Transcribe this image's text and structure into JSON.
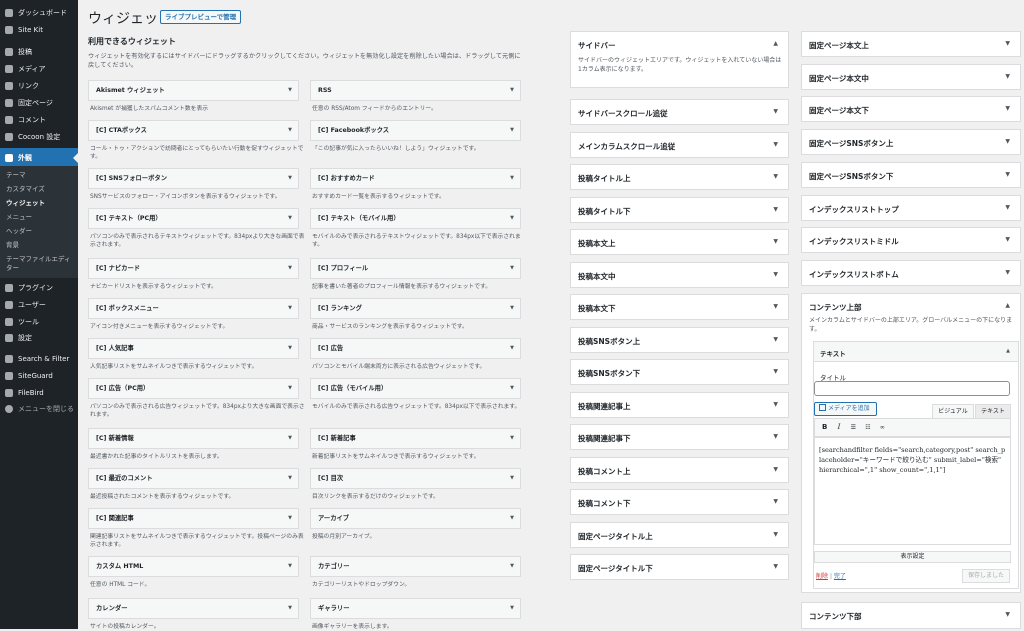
{
  "admin_menu": {
    "dashboard": "ダッシュボード",
    "sitekit": "Site Kit",
    "posts": "投稿",
    "media": "メディア",
    "links": "リンク",
    "pages": "固定ページ",
    "comments": "コメント",
    "cocoon": "Cocoon 設定",
    "appearance": "外観",
    "sub": [
      "テーマ",
      "カスタマイズ",
      "ウィジェット",
      "メニュー",
      "ヘッダー",
      "背景",
      "テーマファイルエディ",
      "ター"
    ],
    "plugins": "プラグイン",
    "users": "ユーザー",
    "tools": "ツール",
    "settings": "設定",
    "searchfilter": "Search & Filter",
    "siteguard": "SiteGuard",
    "filebird": "FileBird",
    "collapse": "メニューを閉じる"
  },
  "page": {
    "title": "ウィジェット",
    "live_preview": "ライブプレビューで管理",
    "available_heading": "利用できるウィジェット",
    "available_desc": "ウィジェットを有効化するにはサイドバーにドラッグするかクリックしてください。ウィジェットを無効化し設定を削除したい場合は、ドラッグして元側に戻してください。"
  },
  "widgets": [
    {
      "name": "Akismet ウィジェット",
      "desc": "Akismet が捕獲したスパムコメント数を表示"
    },
    {
      "name": "RSS",
      "desc": "任意の RSS/Atom フィードからのエントリー。"
    },
    {
      "name": "[C] CTAボックス",
      "desc": "コール・トゥ・アクションで訪問者にとってもらいたい行動を促すウィジェットです。"
    },
    {
      "name": "[C] Facebookボックス",
      "desc": "「この記事が気に入ったらいいね！しよう」ウィジェットです。"
    },
    {
      "name": "[C] SNSフォローボタン",
      "desc": "SNSサービスのフォロー・アイコンボタンを表示するウィジェットです。"
    },
    {
      "name": "[C] おすすめカード",
      "desc": "おすすめカード一覧を表示するウィジェットです。"
    },
    {
      "name": "[C] テキスト（PC用）",
      "desc": "パソコンのみで表示されるテキストウィジェットです。834pxより大きな画面で表示されます。"
    },
    {
      "name": "[C] テキスト（モバイル用）",
      "desc": "モバイルのみで表示されるテキストウィジェットです。834px以下で表示されます。"
    },
    {
      "name": "[C] ナビカード",
      "desc": "ナビカードリストを表示するウィジェットです。"
    },
    {
      "name": "[C] プロフィール",
      "desc": "記事を書いた著者のプロフィール情報を表示するウィジェットです。"
    },
    {
      "name": "[C] ボックスメニュー",
      "desc": "アイコン付きメニューを表示するウィジェットです。"
    },
    {
      "name": "[C] ランキング",
      "desc": "商品・サービスのランキングを表示するウィジェットです。"
    },
    {
      "name": "[C] 人気記事",
      "desc": "人気記事リストをサムネイルつきで表示するウィジェットです。"
    },
    {
      "name": "[C] 広告",
      "desc": "パソコンとモバイル端末両方に表示される広告ウィジェットです。"
    },
    {
      "name": "[C] 広告（PC用）",
      "desc": "パソコンのみで表示される広告ウィジェットです。834pxより大きな画面で表示されます。"
    },
    {
      "name": "[C] 広告（モバイル用）",
      "desc": "モバイルのみで表示される広告ウィジェットです。834px以下で表示されます。"
    },
    {
      "name": "[C] 新着情報",
      "desc": "最近書かれた記事のタイトルリストを表示します。"
    },
    {
      "name": "[C] 新着記事",
      "desc": "新着記事リストをサムネイルつきで表示するウィジェットです。"
    },
    {
      "name": "[C] 最近のコメント",
      "desc": "最近投稿されたコメントを表示するウィジェットです。"
    },
    {
      "name": "[C] 目次",
      "desc": "目次リンクを表示するだけのウィジェットです。"
    },
    {
      "name": "[C] 関連記事",
      "desc": "関連記事リストをサムネイルつきで表示するウィジェットです。投稿ページのみ表示されます。"
    },
    {
      "name": "アーカイブ",
      "desc": "投稿の月別アーカイブ。"
    },
    {
      "name": "カスタム HTML",
      "desc": "任意の HTML コード。"
    },
    {
      "name": "カテゴリー",
      "desc": "カテゴリーリストやドロップダウン。"
    },
    {
      "name": "カレンダー",
      "desc": "サイトの投稿カレンダー。"
    },
    {
      "name": "ギャラリー",
      "desc": "画像ギャラリーを表示します。"
    }
  ],
  "areas_mid": [
    {
      "name": "サイドバー",
      "desc": "サイドバーのウィジェットエリアです。ウィジェットを入れていない場合は1カラム表示になります。",
      "open": true
    },
    {
      "name": "サイドバースクロール追従"
    },
    {
      "name": "メインカラムスクロール追従"
    },
    {
      "name": "投稿タイトル上"
    },
    {
      "name": "投稿タイトル下"
    },
    {
      "name": "投稿本文上"
    },
    {
      "name": "投稿本文中"
    },
    {
      "name": "投稿本文下"
    },
    {
      "name": "投稿SNSボタン上"
    },
    {
      "name": "投稿SNSボタン下"
    },
    {
      "name": "投稿関連記事上"
    },
    {
      "name": "投稿関連記事下"
    },
    {
      "name": "投稿コメント上"
    },
    {
      "name": "投稿コメント下"
    },
    {
      "name": "固定ページタイトル上"
    },
    {
      "name": "固定ページタイトル下"
    }
  ],
  "areas_right": [
    {
      "name": "固定ページ本文上"
    },
    {
      "name": "固定ページ本文中"
    },
    {
      "name": "固定ページ本文下"
    },
    {
      "name": "固定ページSNSボタン上"
    },
    {
      "name": "固定ページSNSボタン下"
    },
    {
      "name": "インデックスリストトップ"
    },
    {
      "name": "インデックスリストミドル"
    },
    {
      "name": "インデックスリストボトム"
    },
    {
      "name": "コンテンツ上部",
      "desc": "メインカラムとサイドバーの上部エリア。グローバルメニューの下になります。"
    },
    {
      "name": "コンテンツ下部"
    }
  ],
  "text_widget": {
    "header": "テキスト",
    "title_label": "タイトル",
    "title_value": "",
    "add_media": "メディアを追加",
    "tab_visual": "ビジュアル",
    "tab_text": "テキスト",
    "content": "[searchandfilter fields=\"search,category,post\" search_placeholder=\"キーワードで絞り込む\" submit_label=\"検索\" hierarchical=\",1\" show_count=\",1,1\"]",
    "display_settings": "表示設定",
    "delete": "削除",
    "separator": "|",
    "done": "完了",
    "saved": "保存しました"
  },
  "colors": {
    "admin_bar": "#1d2327",
    "active": "#2271b1",
    "delete": "#d63638"
  }
}
